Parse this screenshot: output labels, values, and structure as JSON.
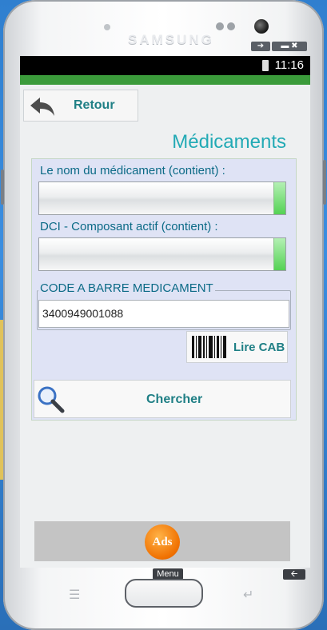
{
  "device": {
    "brand": "SAMSUNG",
    "window_controls": [
      "➔",
      "▬ ✖"
    ]
  },
  "status_bar": {
    "time": "11:16"
  },
  "toolbar": {
    "back_label": "Retour"
  },
  "page": {
    "title": "Médicaments"
  },
  "form": {
    "name_label": "Le nom du médicament (contient) :",
    "name_value": "",
    "dci_label": "DCI - Composant actif (contient) :",
    "dci_value": "",
    "barcode_legend": "CODE A BARRE MEDICAMENT",
    "barcode_value": "3400949001088",
    "read_barcode_label": "Lire CAB",
    "search_label": "Chercher"
  },
  "ads": {
    "label": "Ads"
  },
  "nav": {
    "menu_label": "Menu"
  },
  "colors": {
    "accent_teal": "#22aab5",
    "status_green": "#3b9b3b",
    "panel_bg": "#dfe3f5"
  }
}
